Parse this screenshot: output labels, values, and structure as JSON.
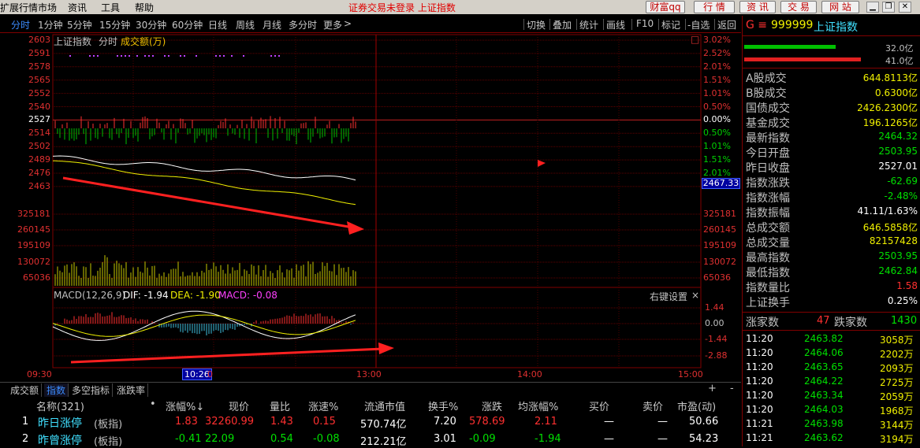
{
  "menubar": {
    "items": [
      "扩展行情市场",
      "资讯",
      "工具",
      "帮助"
    ],
    "status": "证券交易未登录  上证指数",
    "buttons": [
      "财富qq",
      "行 情",
      "资 讯",
      "交 易",
      "网 站"
    ],
    "window_controls": [
      "close-icon",
      "restore-icon",
      "minimize-icon"
    ]
  },
  "period_tabs": [
    "分时",
    "1分钟",
    "5分钟",
    "15分钟",
    "30分钟",
    "60分钟",
    "日线",
    "周线",
    "月线",
    "多分时",
    "更多"
  ],
  "period_active": "分时",
  "period_more_suffix": ">",
  "tools": [
    "切换",
    "叠加",
    "统计",
    "画线",
    "F10",
    "标记",
    "-自选",
    "返回"
  ],
  "chart": {
    "title": "上证指数",
    "mode": "分时",
    "vol_label": "成交额(万)",
    "price_axis": [
      "2603",
      "2591",
      "2578",
      "2565",
      "2552",
      "2540",
      "2527",
      "2514",
      "2502",
      "2489",
      "2476",
      "2463"
    ],
    "pct_axis": [
      "3.02%",
      "2.52%",
      "2.01%",
      "1.51%",
      "1.01%",
      "0.50%",
      "0.00%",
      "0.50%",
      "1.01%",
      "1.51%",
      "2.01%",
      "2.52%"
    ],
    "current_price_tag": "2467.33",
    "vol_axis_left": [
      "325181",
      "260145",
      "195109",
      "130072",
      "65036"
    ],
    "vol_axis_right": [
      "325181",
      "260145",
      "195109",
      "130072",
      "65036"
    ],
    "macd_label": "MACD(12,26,9)",
    "dif": "DIF: -1.94",
    "dea": "DEA: -1.90",
    "macd": "MACD: -0.08",
    "macd_settings": "右键设置",
    "macd_close": "×",
    "macd_axis": [
      "1.44",
      "0.00",
      "-1.44",
      "-2.88"
    ],
    "time_axis": [
      "09:30",
      "10:26",
      "0",
      "13:00",
      "14:00",
      "15:00"
    ],
    "time_highlight": "10:26",
    "chart_close": "□"
  },
  "right_panel": {
    "code": "999999",
    "name": "上证指数",
    "prefix": "G ≡",
    "bar_up_value": "32.0亿",
    "bar_down_value": "41.0亿",
    "stats": [
      {
        "label": "A股成交",
        "value": "644.8113亿",
        "color": "yellow"
      },
      {
        "label": "B股成交",
        "value": "0.6300亿",
        "color": "yellow"
      },
      {
        "label": "国债成交",
        "value": "2426.2300亿",
        "color": "yellow"
      },
      {
        "label": "基金成交",
        "value": "196.1265亿",
        "color": "yellow"
      },
      {
        "label": "最新指数",
        "value": "2464.32",
        "color": "green"
      },
      {
        "label": "今日开盘",
        "value": "2503.95",
        "color": "green"
      },
      {
        "label": "昨日收盘",
        "value": "2527.01",
        "color": "white"
      },
      {
        "label": "指数涨跌",
        "value": "-62.69",
        "color": "green"
      },
      {
        "label": "指数涨幅",
        "value": "-2.48%",
        "color": "green"
      },
      {
        "label": "指数振幅",
        "value": "41.11/1.63%",
        "color": "white"
      },
      {
        "label": "总成交额",
        "value": "646.5858亿",
        "color": "yellow"
      },
      {
        "label": "总成交量",
        "value": "82157428",
        "color": "yellow"
      },
      {
        "label": "最高指数",
        "value": "2503.95",
        "color": "green"
      },
      {
        "label": "最低指数",
        "value": "2462.84",
        "color": "green"
      },
      {
        "label": "指数量比",
        "value": "1.58",
        "color": "red"
      },
      {
        "label": "上证换手",
        "value": "0.25%",
        "color": "white"
      }
    ],
    "rise_label": "涨家数",
    "rise_count": "47",
    "fall_label": "跌家数",
    "fall_count": "1430",
    "ticks": [
      {
        "time": "11:20",
        "price": "2463.82",
        "vol": "3058万"
      },
      {
        "time": "11:20",
        "price": "2464.06",
        "vol": "2202万"
      },
      {
        "time": "11:20",
        "price": "2463.65",
        "vol": "2093万"
      },
      {
        "time": "11:20",
        "price": "2464.22",
        "vol": "2725万"
      },
      {
        "time": "11:20",
        "price": "2463.34",
        "vol": "2059万"
      },
      {
        "time": "11:20",
        "price": "2464.03",
        "vol": "1968万"
      },
      {
        "time": "11:21",
        "price": "2463.98",
        "vol": "3144万"
      },
      {
        "time": "11:21",
        "price": "2463.62",
        "vol": "3194万"
      }
    ]
  },
  "bottom_tabs": [
    "成交额",
    "指数",
    "多空指标",
    "涨跌率"
  ],
  "bottom_active": "指数",
  "bottom_controls": [
    "+",
    "-"
  ],
  "table": {
    "headers": [
      "名称(321)",
      "•",
      "涨幅%↓",
      "现价",
      "量比",
      "涨速%",
      "流通市值",
      "换手%",
      "涨跌",
      "均涨幅%",
      "买价",
      "卖价",
      "市盈(动)"
    ],
    "rows": [
      {
        "idx": "1",
        "name": "昨日涨停",
        "tag": "(板指)",
        "chg": "1.83",
        "price": "32260.99",
        "lb": "1.43",
        "speed": "0.15",
        "mcap": "570.74亿",
        "turn": "7.20",
        "diff": "578.69",
        "avg": "2.11",
        "buy": "—",
        "sell": "—",
        "pe": "50.66"
      },
      {
        "idx": "2",
        "name": "昨曾涨停",
        "tag": "(板指)",
        "chg": "-0.41",
        "price": "22.09",
        "lb": "0.54",
        "speed": "-0.08",
        "mcap": "212.21亿",
        "turn": "3.01",
        "diff": "-0.09",
        "avg": "-1.94",
        "buy": "—",
        "sell": "—",
        "pe": "54.23"
      }
    ]
  },
  "colors": {
    "up": "#ff3030",
    "down": "#00e000",
    "grid": "#800000",
    "accent": "#3c8cff"
  }
}
